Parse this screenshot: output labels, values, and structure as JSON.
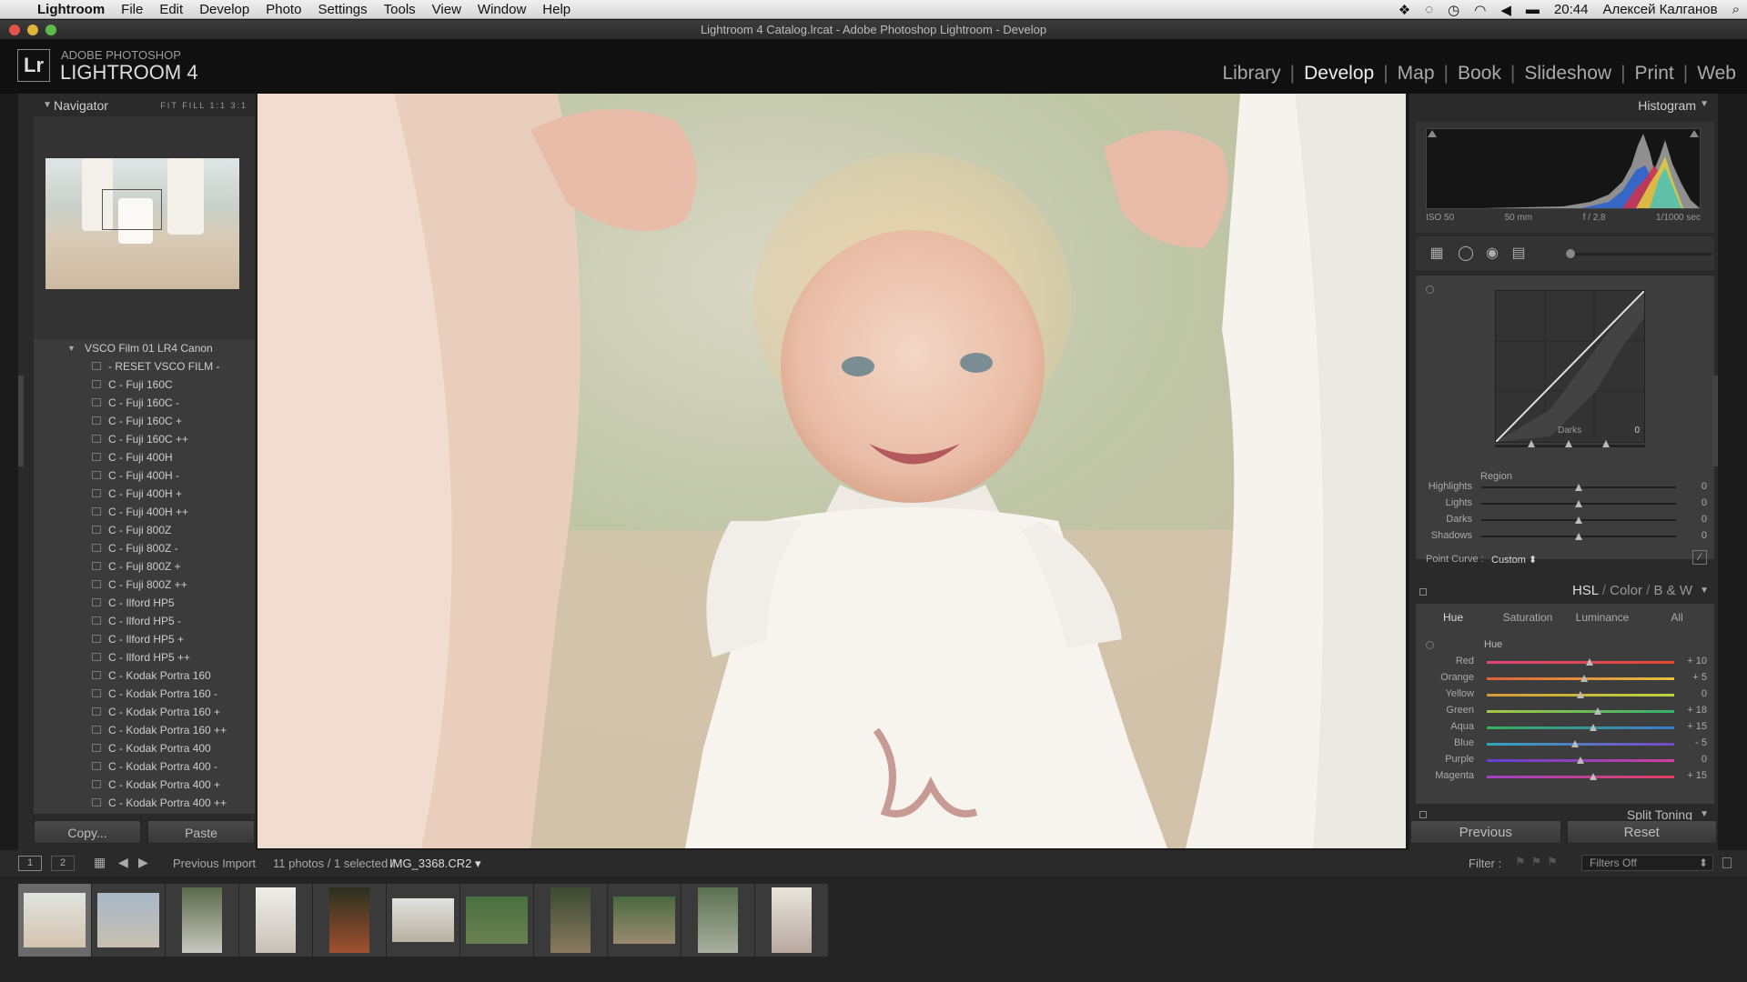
{
  "menubar": {
    "app": "Lightroom",
    "items": [
      "File",
      "Edit",
      "Develop",
      "Photo",
      "Settings",
      "Tools",
      "View",
      "Window",
      "Help"
    ],
    "clock": "20:44",
    "user": "Алексей Калганов"
  },
  "window": {
    "title": "Lightroom 4 Catalog.lrcat - Adobe Photoshop Lightroom - Develop"
  },
  "header": {
    "logo": "Lr",
    "brand_top": "ADOBE PHOTOSHOP",
    "brand_main": "LIGHTROOM 4",
    "modules": [
      "Library",
      "Develop",
      "Map",
      "Book",
      "Slideshow",
      "Print",
      "Web"
    ],
    "active_module": "Develop"
  },
  "navigator": {
    "title": "Navigator",
    "options": [
      "FIT",
      "FILL",
      "1:1",
      "3:1"
    ]
  },
  "presets": {
    "group": "VSCO Film 01 LR4 Canon",
    "items": [
      "- RESET VSCO FILM -",
      "C - Fuji 160C",
      "C - Fuji 160C -",
      "C - Fuji 160C +",
      "C - Fuji 160C ++",
      "C - Fuji 400H",
      "C - Fuji 400H -",
      "C - Fuji 400H +",
      "C - Fuji 400H ++",
      "C - Fuji 800Z",
      "C - Fuji 800Z -",
      "C - Fuji 800Z +",
      "C - Fuji 800Z ++",
      "C - Ilford HP5",
      "C - Ilford HP5 -",
      "C - Ilford HP5 +",
      "C - Ilford HP5 ++",
      "C - Kodak Portra 160",
      "C - Kodak Portra 160 -",
      "C - Kodak Portra 160 +",
      "C - Kodak Portra 160 ++",
      "C - Kodak Portra 400",
      "C - Kodak Portra 400 -",
      "C - Kodak Portra 400 +",
      "C - Kodak Portra 400 ++"
    ]
  },
  "left_buttons": {
    "copy": "Copy...",
    "paste": "Paste"
  },
  "histogram": {
    "title": "Histogram",
    "iso": "ISO 50",
    "focal": "50 mm",
    "aperture": "f / 2,8",
    "shutter": "1/1000 sec"
  },
  "tone_curve": {
    "curve_label": "Darks",
    "curve_value": "0",
    "region_title": "Region",
    "rows": [
      {
        "label": "Highlights",
        "value": "0",
        "pos": 0.5
      },
      {
        "label": "Lights",
        "value": "0",
        "pos": 0.5
      },
      {
        "label": "Darks",
        "value": "0",
        "pos": 0.5
      },
      {
        "label": "Shadows",
        "value": "0",
        "pos": 0.5
      }
    ],
    "point_curve_label": "Point Curve :",
    "point_curve_value": "Custom"
  },
  "hsl": {
    "header": [
      "HSL",
      "Color",
      "B & W"
    ],
    "tabs": [
      "Hue",
      "Saturation",
      "Luminance",
      "All"
    ],
    "active_tab": "Hue",
    "section": "Hue",
    "rows": [
      {
        "label": "Red",
        "value": "+ 10",
        "pos": 0.55,
        "c1": "#e0447a",
        "c2": "#e34a30"
      },
      {
        "label": "Orange",
        "value": "+ 5",
        "pos": 0.52,
        "c1": "#e0603a",
        "c2": "#e5c040"
      },
      {
        "label": "Yellow",
        "value": "0",
        "pos": 0.5,
        "c1": "#d79a3a",
        "c2": "#b8d640"
      },
      {
        "label": "Green",
        "value": "+ 18",
        "pos": 0.59,
        "c1": "#a8c840",
        "c2": "#35b070"
      },
      {
        "label": "Aqua",
        "value": "+ 15",
        "pos": 0.57,
        "c1": "#36b058",
        "c2": "#3a7ad0"
      },
      {
        "label": "Blue",
        "value": "- 5",
        "pos": 0.47,
        "c1": "#30a8c0",
        "c2": "#7a48c8"
      },
      {
        "label": "Purple",
        "value": "0",
        "pos": 0.5,
        "c1": "#6040d0",
        "c2": "#d040a0"
      },
      {
        "label": "Magenta",
        "value": "+ 15",
        "pos": 0.57,
        "c1": "#a040c8",
        "c2": "#e04060"
      }
    ]
  },
  "split_toning": "Split Toning",
  "right_buttons": {
    "previous": "Previous",
    "reset": "Reset"
  },
  "filmbar": {
    "screen1": "1",
    "screen2": "2",
    "source": "Previous Import",
    "count": "11 photos / 1 selected /",
    "filename": "IMG_3368.CR2",
    "filter_label": "Filter :",
    "filter_value": "Filters Off"
  },
  "colors": {
    "accent": "#e6e6e6",
    "panel": "#3a3a3a",
    "background": "#1b1b1b"
  }
}
